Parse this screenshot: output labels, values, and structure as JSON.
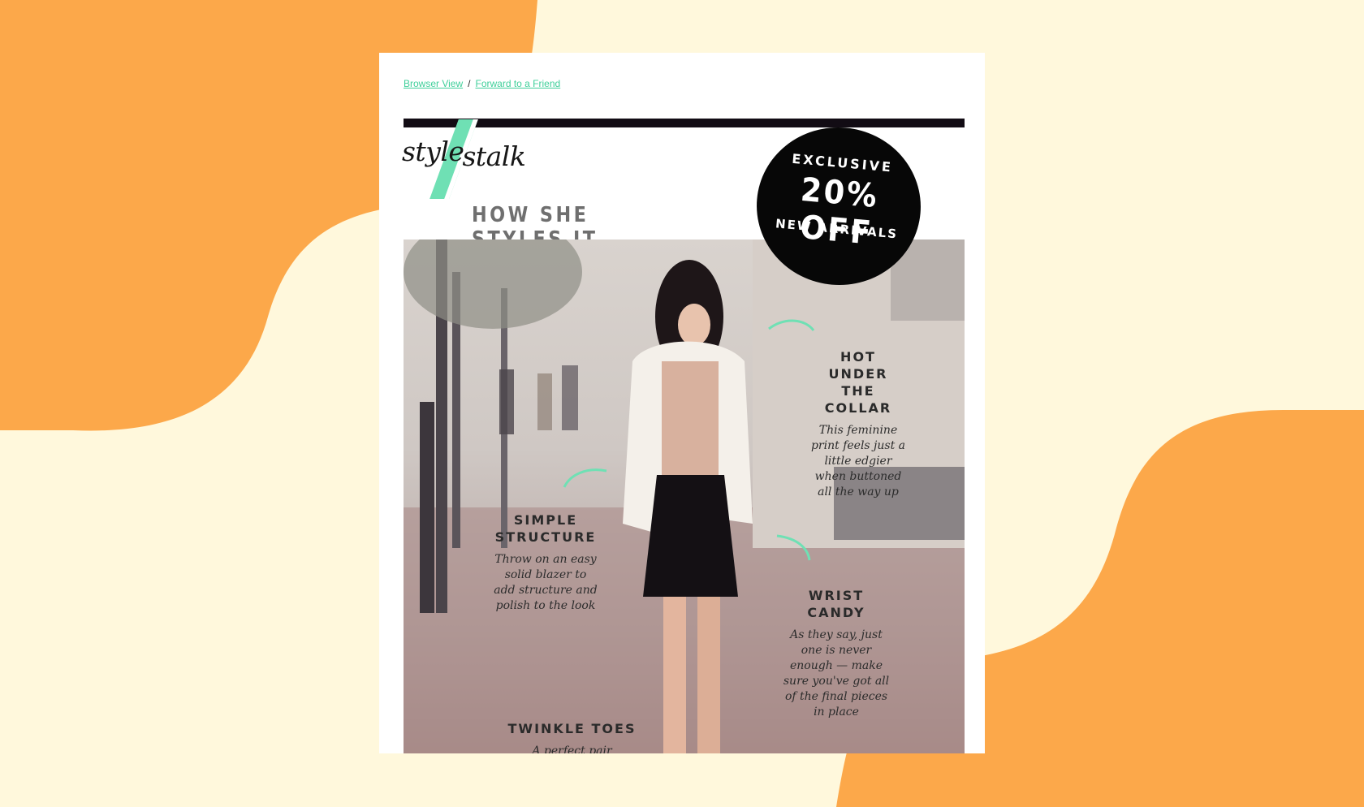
{
  "colors": {
    "background": "#fff8dc",
    "blob": "#fca84a",
    "accent": "#6fe0b4",
    "link": "#3fcf9a",
    "badge": "#070707"
  },
  "email": {
    "toplinks": {
      "browser_view": "Browser View",
      "separator": "/",
      "forward": "Forward to a Friend"
    },
    "logo": {
      "part1": "style",
      "part2": "stalk"
    },
    "headline": "HOW SHE STYLES IT",
    "badge": {
      "line1": "EXCLUSIVE",
      "line2": "20% OFF",
      "line3": "NEW ARRIVALS"
    },
    "callouts": [
      {
        "title": "HOT UNDER THE COLLAR",
        "text": "This feminine print feels just a little edgier when buttoned all the way up"
      },
      {
        "title": "SIMPLE STRUCTURE",
        "text": "Throw on an easy solid blazer to add structure and polish to the look"
      },
      {
        "title": "WRIST CANDY",
        "text": "As they say, just one is never enough — make sure you've got all of the final pieces in place"
      },
      {
        "title": "TWINKLE TOES",
        "text": "A perfect pair"
      }
    ]
  }
}
